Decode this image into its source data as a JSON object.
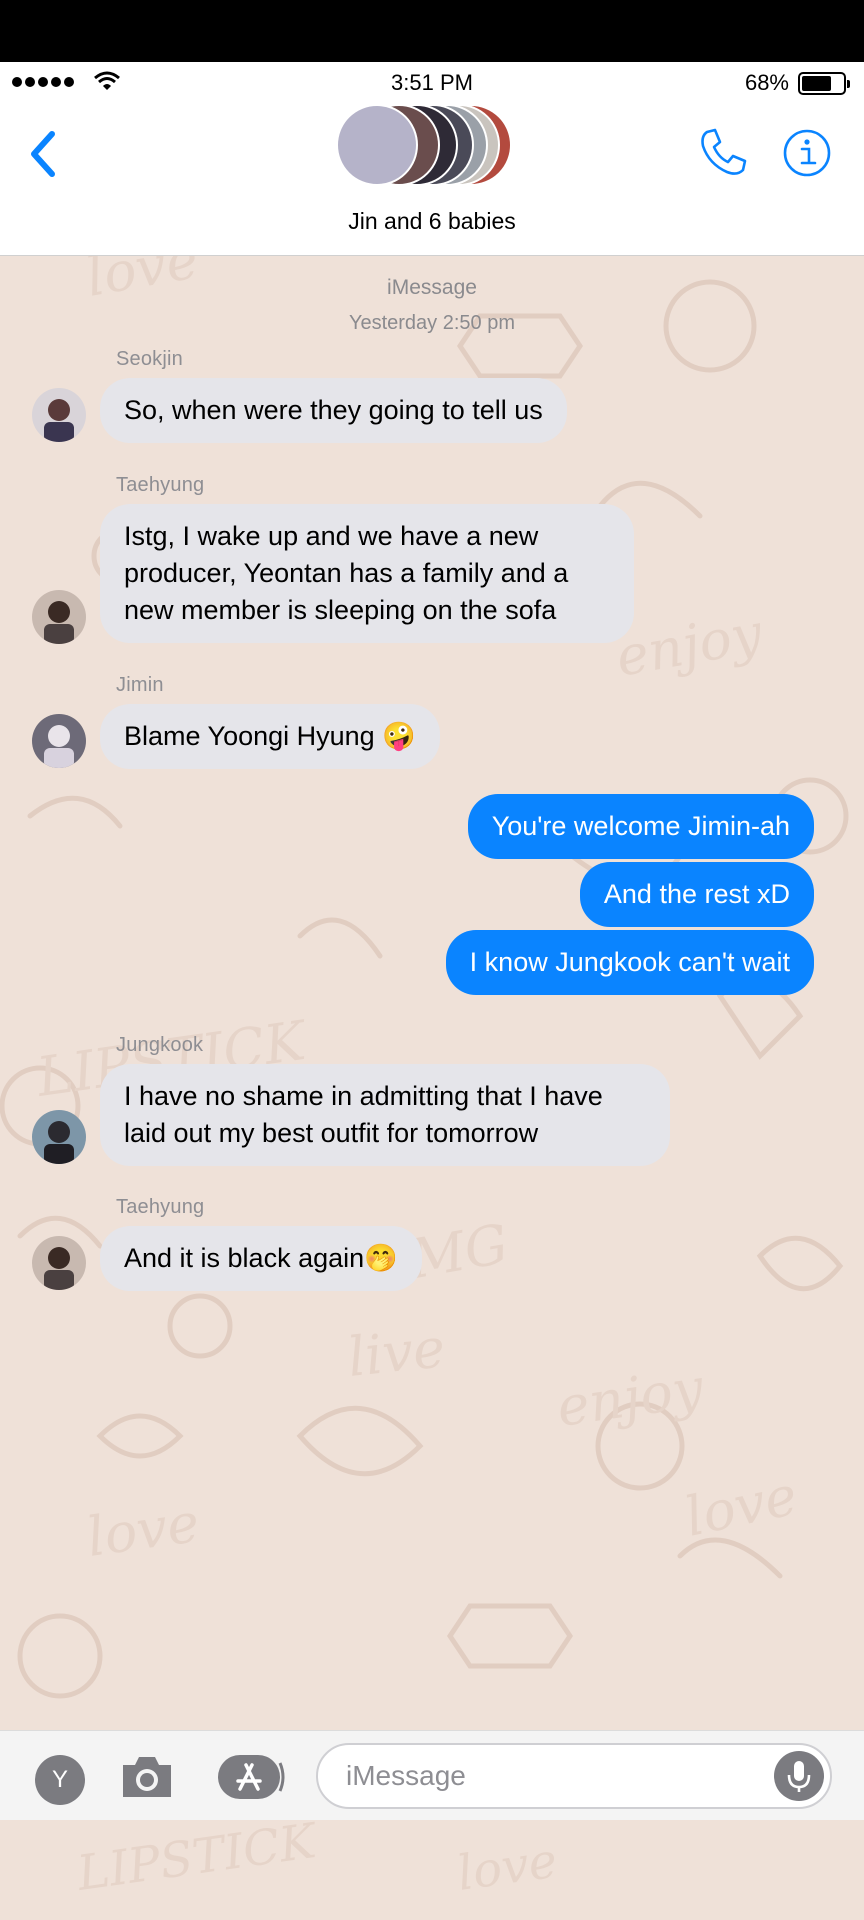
{
  "status": {
    "time": "3:51 PM",
    "battery": "68%"
  },
  "header": {
    "title": "Jin and 6 babies",
    "stack_colors": [
      "#b5b3c9",
      "#6a4d4d",
      "#2e2a36",
      "#4a4a58",
      "#9aa0a8",
      "#c9c4be",
      "#b34a3e"
    ]
  },
  "chat": {
    "service": "iMessage",
    "timestamp": "Yesterday 2:50 pm",
    "messages": [
      {
        "sender": "Seokjin",
        "text": "So, when were they going to tell us"
      },
      {
        "sender": "Taehyung",
        "text": "Istg, I wake up and we have a new producer, Yeontan has a family and a new member is sleeping on the sofa"
      },
      {
        "sender": "Jimin",
        "text": "Blame Yoongi Hyung 🤪"
      },
      {
        "text": "You're welcome Jimin-ah"
      },
      {
        "text": "And the rest xD"
      },
      {
        "text": "I know Jungkook can't wait"
      },
      {
        "sender": "Jungkook",
        "text": "I have no shame in admitting that I have laid out my best outfit for tomorrow"
      },
      {
        "sender": "Taehyung",
        "text": "And it is black again🤭"
      }
    ]
  },
  "input_bar": {
    "y_label": "Y",
    "placeholder": "iMessage"
  },
  "colors": {
    "accent": "#0a84ff",
    "incoming_bubble": "#e5e5ea",
    "wallpaper": "#efe1d8"
  },
  "icons": [
    "back-chevron-icon",
    "phone-icon",
    "info-icon",
    "camera-icon",
    "app-store-icon",
    "microphone-icon",
    "wifi-icon"
  ]
}
